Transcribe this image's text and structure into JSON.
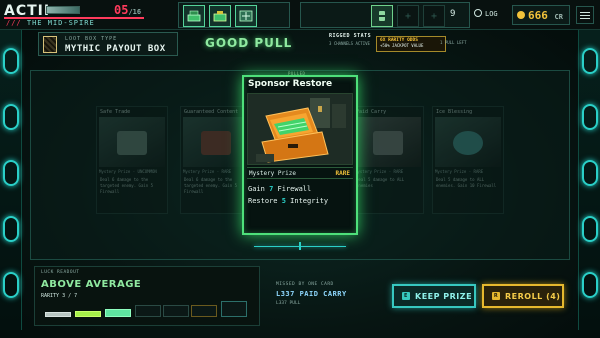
{
  "hud": {
    "act": "ACTII",
    "hp": "05",
    "hp_max": "/16",
    "location_prefix": "///",
    "location": "THE MID-SPIRE",
    "relics": [
      "relic-1",
      "relic-2",
      "relic-3"
    ],
    "slot_plus_1": "+",
    "slot_plus_2": "+",
    "count": "9",
    "log_label": "LOG",
    "credits": "666",
    "credits_unit": "CR"
  },
  "header": {
    "box_type_label": "LOOT BOX TYPE",
    "box_type": "MYTHIC PAYOUT BOX",
    "result": "GOOD PULL",
    "rigged_title": "RIGGED STATS",
    "rigged_sub": "3 CHANNELS ACTIVE",
    "odds_a": "6X RARITY ODDS",
    "odds_b": "+50% JACKPOT VALUE",
    "pulls_left": "1 PULL LEFT"
  },
  "cards": {
    "left_1": {
      "name": "Safe Trade",
      "rarity": "Mystery Prize",
      "rarity_tag": "UNCOMMON",
      "desc": "Deal 6 damage to the targeted enemy. Gain 5 Firewall"
    },
    "left_2": {
      "name": "Guaranteed Content",
      "rarity": "Mystery Prize",
      "rarity_tag": "RARE",
      "desc": "Deal 6 damage to the targeted enemy. Gain 5 Firewall"
    },
    "right_1": {
      "name": "Paid Carry",
      "rarity": "Mystery Prize",
      "rarity_tag": "RARE",
      "desc": "Deal 5 damage to ALL enemies"
    },
    "right_2": {
      "name": "Ice Blessing",
      "rarity": "Mystery Prize",
      "rarity_tag": "RARE",
      "desc": "Deal 5 damage to ALL enemies. Gain 10 Firewall"
    },
    "main": {
      "tag": "PULLED",
      "name": "Sponsor Restore",
      "rarity": "Mystery Prize",
      "rarity_tag": "RARE",
      "line1_pre": "Gain ",
      "line1_num": "7",
      "line1_post": " Firewall",
      "line2_pre": "Restore ",
      "line2_num": "5",
      "line2_post": " Integrity"
    }
  },
  "luck": {
    "label": "LUCK READOUT",
    "value": "ABOVE AVERAGE",
    "rarity": "RARITY 3 / 7"
  },
  "missed": {
    "label": "MISSED BY ONE CARD",
    "value": "L337 PAID CARRY",
    "sub": "L337 PULL"
  },
  "actions": {
    "keep_key": "E",
    "keep": "KEEP PRIZE",
    "reroll_key": "R",
    "reroll": "REROLL (4)"
  },
  "colors": {
    "accent_green": "#4ee07a",
    "accent_cyan": "#37c8c0",
    "accent_gold": "#e6b82e",
    "hp_red": "#ff3b5c"
  }
}
